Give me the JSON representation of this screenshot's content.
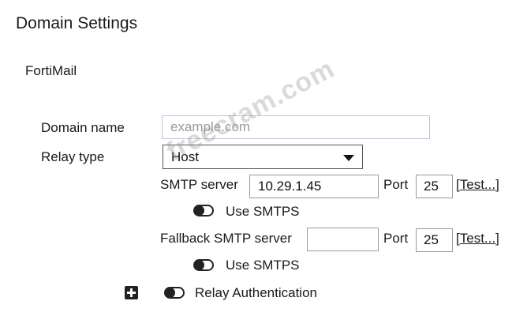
{
  "page_title": "Domain Settings",
  "section_title": "FortiMail",
  "domain": {
    "label": "Domain name",
    "placeholder": "example.com",
    "value": ""
  },
  "relay": {
    "label": "Relay type",
    "selected": "Host"
  },
  "smtp": {
    "label": "SMTP server",
    "value": "10.29.1.45",
    "port_label": "Port",
    "port": "25",
    "test_open": "[",
    "test_label": "Test...",
    "test_close": "]",
    "use_smtps_label": "Use SMTPS"
  },
  "fallback": {
    "label": "Fallback SMTP server",
    "value": "",
    "port_label": "Port",
    "port": "25",
    "test_open": "[",
    "test_label": "Test...",
    "test_close": "]",
    "use_smtps_label": "Use SMTPS"
  },
  "relay_auth": {
    "label": "Relay Authentication"
  },
  "watermark": "freecram.com"
}
